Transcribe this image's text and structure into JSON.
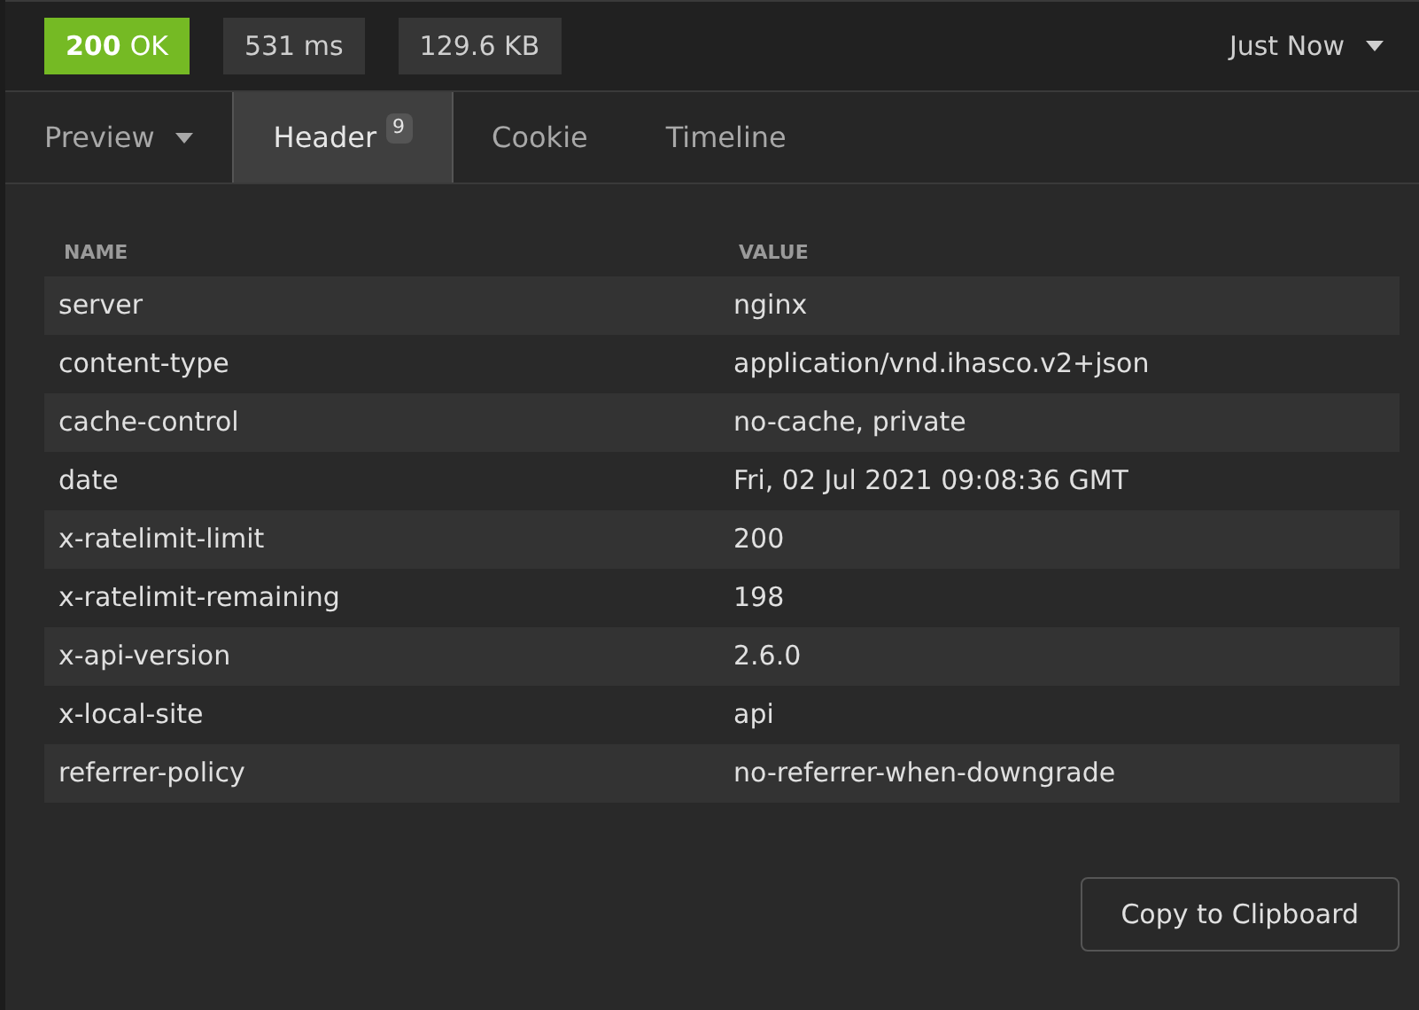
{
  "status": {
    "code": "200",
    "text": "OK"
  },
  "time": "531 ms",
  "size": "129.6 KB",
  "history": {
    "label": "Just Now"
  },
  "tabs": [
    {
      "label": "Preview",
      "selected": false,
      "dropdown": true
    },
    {
      "label": "Header",
      "selected": true,
      "count": "9"
    },
    {
      "label": "Cookie",
      "selected": false
    },
    {
      "label": "Timeline",
      "selected": false
    }
  ],
  "table": {
    "columns": [
      "NAME",
      "VALUE"
    ],
    "rows": [
      [
        "server",
        "nginx"
      ],
      [
        "content-type",
        "application/vnd.ihasco.v2+json"
      ],
      [
        "cache-control",
        "no-cache, private"
      ],
      [
        "date",
        "Fri, 02 Jul 2021 09:08:36 GMT"
      ],
      [
        "x-ratelimit-limit",
        "200"
      ],
      [
        "x-ratelimit-remaining",
        "198"
      ],
      [
        "x-api-version",
        "2.6.0"
      ],
      [
        "x-local-site",
        "api"
      ],
      [
        "referrer-policy",
        "no-referrer-when-downgrade"
      ]
    ]
  },
  "copy_button": "Copy to Clipboard"
}
